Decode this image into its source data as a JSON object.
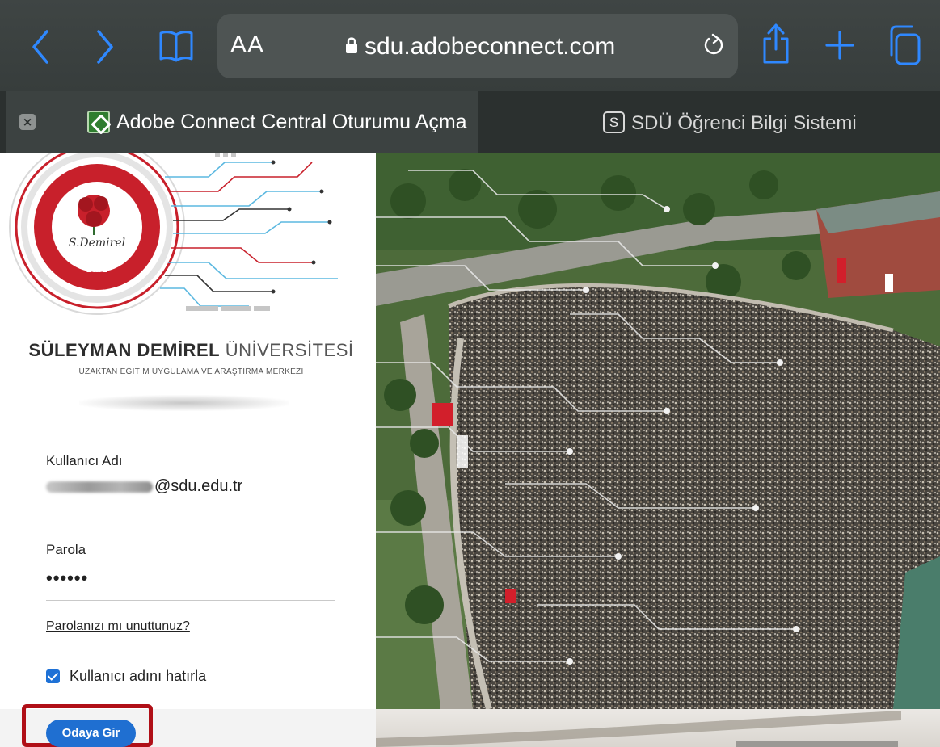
{
  "browser": {
    "address": "sdu.adobeconnect.com",
    "text_size_button": "AA",
    "tabs": [
      {
        "title": "Adobe Connect Central Oturumu Açma",
        "active": true,
        "favicon": "adobe-connect-icon"
      },
      {
        "title": "SDÜ Öğrenci Bilgi Sistemi",
        "active": false,
        "favicon_letter": "S"
      }
    ],
    "icons": [
      "back-icon",
      "forward-icon",
      "bookmarks-icon",
      "lock-icon",
      "reload-icon",
      "share-icon",
      "new-tab-icon",
      "tabs-icon",
      "close-tab-icon"
    ]
  },
  "branding": {
    "seal_top_text": "SÜLEYMAN DEMİREL ÜNİVERSİTESİ",
    "seal_signature": "S.Demirel",
    "seal_year": "1992",
    "name_bold": "SÜLEYMAN DEMİREL",
    "name_regular": "ÜNİVERSİTESİ",
    "subtitle": "UZAKTAN EĞİTİM UYGULAMA VE ARAŞTIRMA MERKEZİ"
  },
  "login": {
    "username_label": "Kullanıcı Adı",
    "username_domain": "@sdu.edu.tr",
    "password_label": "Parola",
    "password_masked": "••••••",
    "forgot_link": "Parolanızı mı unuttunuz?",
    "remember_label": "Kullanıcı adını hatırla",
    "remember_checked": true,
    "submit_label": "Odaya Gir"
  },
  "colors": {
    "toolbar": "#3b4140",
    "icon_blue": "#2f88ff",
    "submit": "#1f6fd1",
    "highlight": "#b00f17",
    "seal_red": "#c8202b"
  }
}
